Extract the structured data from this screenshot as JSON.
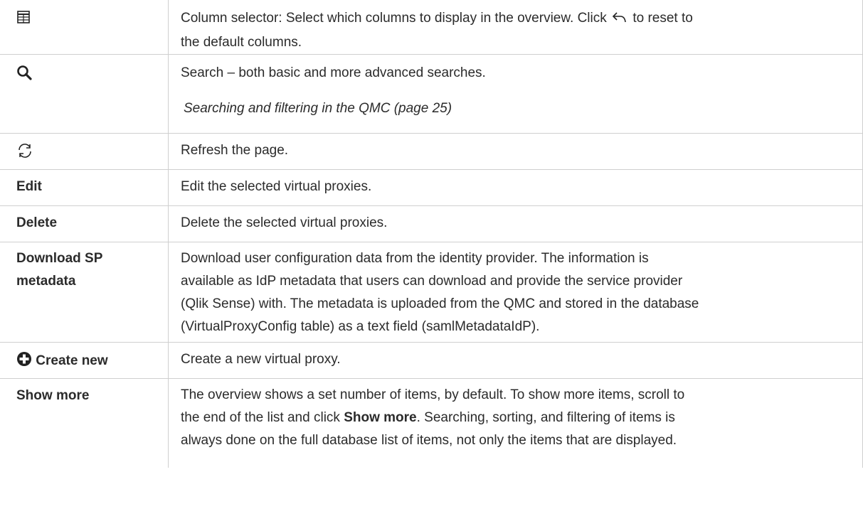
{
  "rows": {
    "columns": {
      "icon": "table-grid-icon",
      "text_before": "Column selector: Select which columns to display in the overview. Click",
      "reset_icon": "undo-arrow-icon",
      "text_after": "to reset to",
      "text_line2": "the default columns."
    },
    "search": {
      "icon": "magnifier-icon",
      "text": "Search – both basic and more advanced searches.",
      "link": "Searching and filtering in the QMC (page 25)"
    },
    "refresh": {
      "icon": "refresh-icon",
      "text": "Refresh the page."
    },
    "edit": {
      "label": "Edit",
      "text": "Edit the selected virtual proxies."
    },
    "delete": {
      "label": "Delete",
      "text": "Delete the selected virtual proxies."
    },
    "sp_metadata": {
      "label_line1": "Download SP",
      "label_line2": "metadata",
      "lines": [
        "Download user configuration data from the identity provider. The information is",
        "available as IdP metadata that users can download and provide the service provider",
        "(Qlik Sense) with. The metadata is uploaded from the QMC and stored in the database",
        "(VirtualProxyConfig table) as a text field (samlMetadataIdP)."
      ]
    },
    "create": {
      "icon": "plus-circle-icon",
      "label": "Create new",
      "text": "Create a new virtual proxy."
    },
    "show_more": {
      "label": "Show more",
      "line1": "The overview shows a set number of items, by default. To show more items, scroll to",
      "line2_before": "the end of the list and click",
      "line2_bold": "Show more",
      "line2_after": ". Searching, sorting, and filtering of items is",
      "line3": "always done on the full database list of items, not only the items that are displayed."
    }
  }
}
